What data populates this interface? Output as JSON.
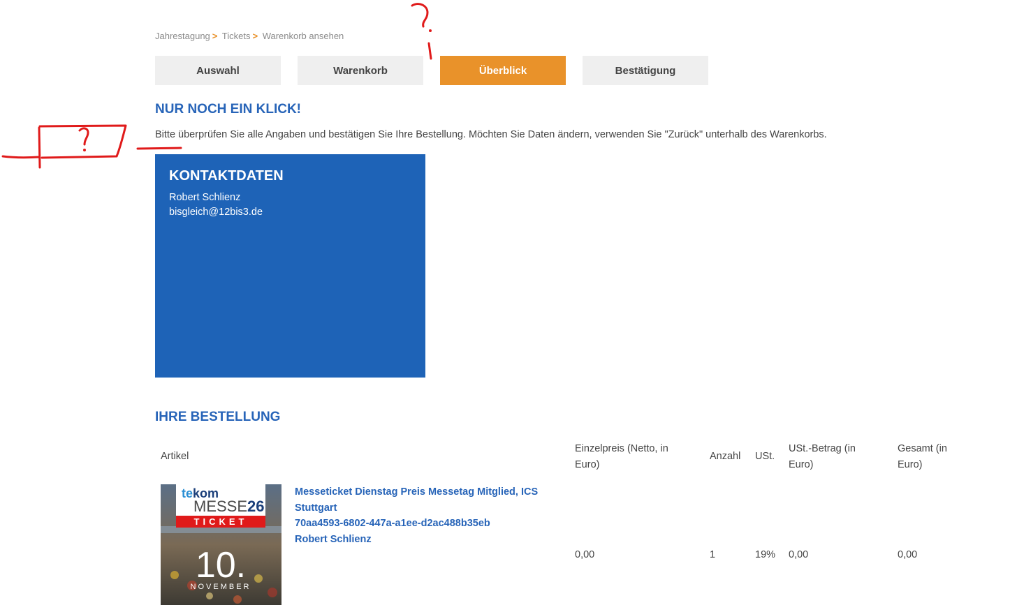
{
  "breadcrumb": [
    "Jahrestagung",
    "Tickets",
    "Warenkorb ansehen"
  ],
  "steps": [
    "Auswahl",
    "Warenkorb",
    "Überblick",
    "Bestätigung"
  ],
  "heading": "NUR NOCH EIN KLICK!",
  "intro": "Bitte überprüfen Sie alle Angaben und bestätigen Sie Ihre Bestellung. Möchten Sie Daten ändern, verwenden Sie \"Zurück\" unterhalb des Warenkorbs.",
  "contact": {
    "title": "KONTAKTDATEN",
    "name": "Robert Schlienz",
    "email": "bisgleich@12bis3.de"
  },
  "order": {
    "title": "IHRE BESTELLUNG",
    "columns": {
      "article": "Artikel",
      "unit_price": "Einzelpreis (Netto, in Euro)",
      "quantity": "Anzahl",
      "vat": "USt.",
      "vat_amount": "USt.-Betrag (in Euro)",
      "total": "Gesamt (in Euro)"
    },
    "item": {
      "image": {
        "brand_a": "te",
        "brand_b": "kom",
        "event": "MESSE",
        "year": "26",
        "ticket": "TICKET",
        "day": "10.",
        "month": "NOVEMBER"
      },
      "name_line1": "Messeticket Dienstag Preis Messetag Mitglied, ICS",
      "name_line2": "Stuttgart",
      "ticket_id": "70aa4593-6802-447a-a1ee-d2ac488b35eb",
      "holder": "Robert Schlienz",
      "unit_price": "0,00",
      "quantity": "1",
      "vat": "19%",
      "vat_amount": "0,00",
      "total": "0,00"
    }
  },
  "annotation": {
    "mark": "?"
  },
  "colors": {
    "primary_blue": "#1e63b7",
    "heading_blue": "#2764b8",
    "active_step": "#e9922a",
    "annotation_red": "#e01a1a"
  }
}
